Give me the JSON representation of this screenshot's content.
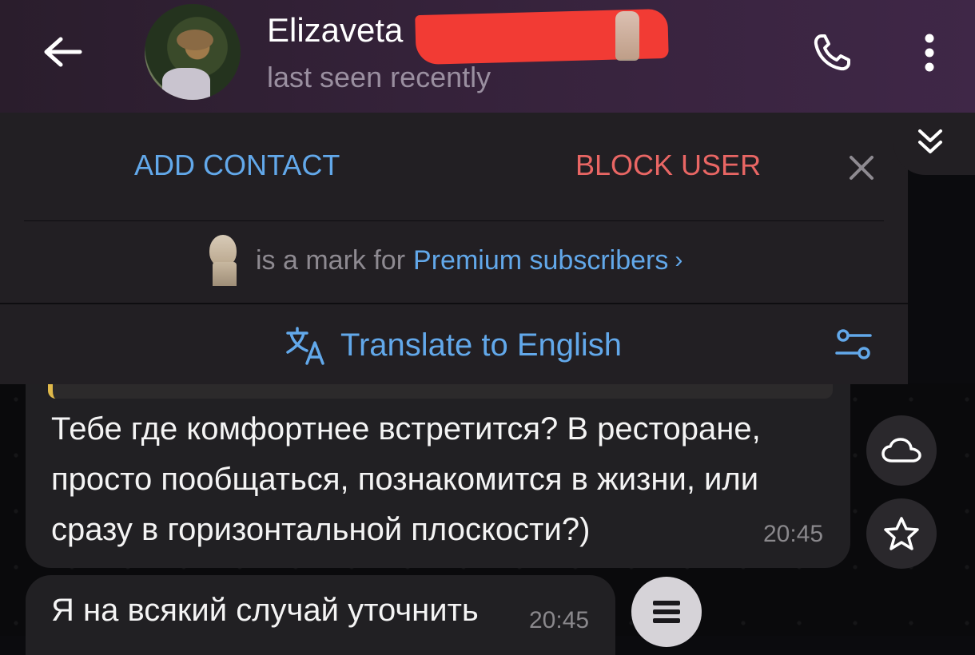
{
  "header": {
    "name": "Elizaveta",
    "status": "last seen recently"
  },
  "actions": {
    "add_contact": "ADD CONTACT",
    "block_user": "BLOCK USER"
  },
  "premium": {
    "text": "is a mark for",
    "link": "Premium subscribers",
    "chevron": "›"
  },
  "translate": {
    "label": "Translate to English"
  },
  "messages": [
    {
      "text": "Тебе где комфортнее встретится? В ресторане, просто пообщаться, познакомится в жизни, или сразу в горизонтальной плоскости?)",
      "time": "20:45"
    },
    {
      "text": "Я на всякий случай уточнить",
      "time": "20:45"
    }
  ],
  "colors": {
    "accent_blue": "#62a8ea",
    "danger_red": "#e96664",
    "redaction": "#f23b34"
  },
  "icons": [
    "back-arrow-icon",
    "phone-icon",
    "more-vertical-icon",
    "collapse-double-chevron-icon",
    "close-icon",
    "bust-emoji-icon",
    "translate-icon",
    "translate-settings-icon",
    "cloud-icon",
    "star-icon",
    "menu-icon"
  ]
}
